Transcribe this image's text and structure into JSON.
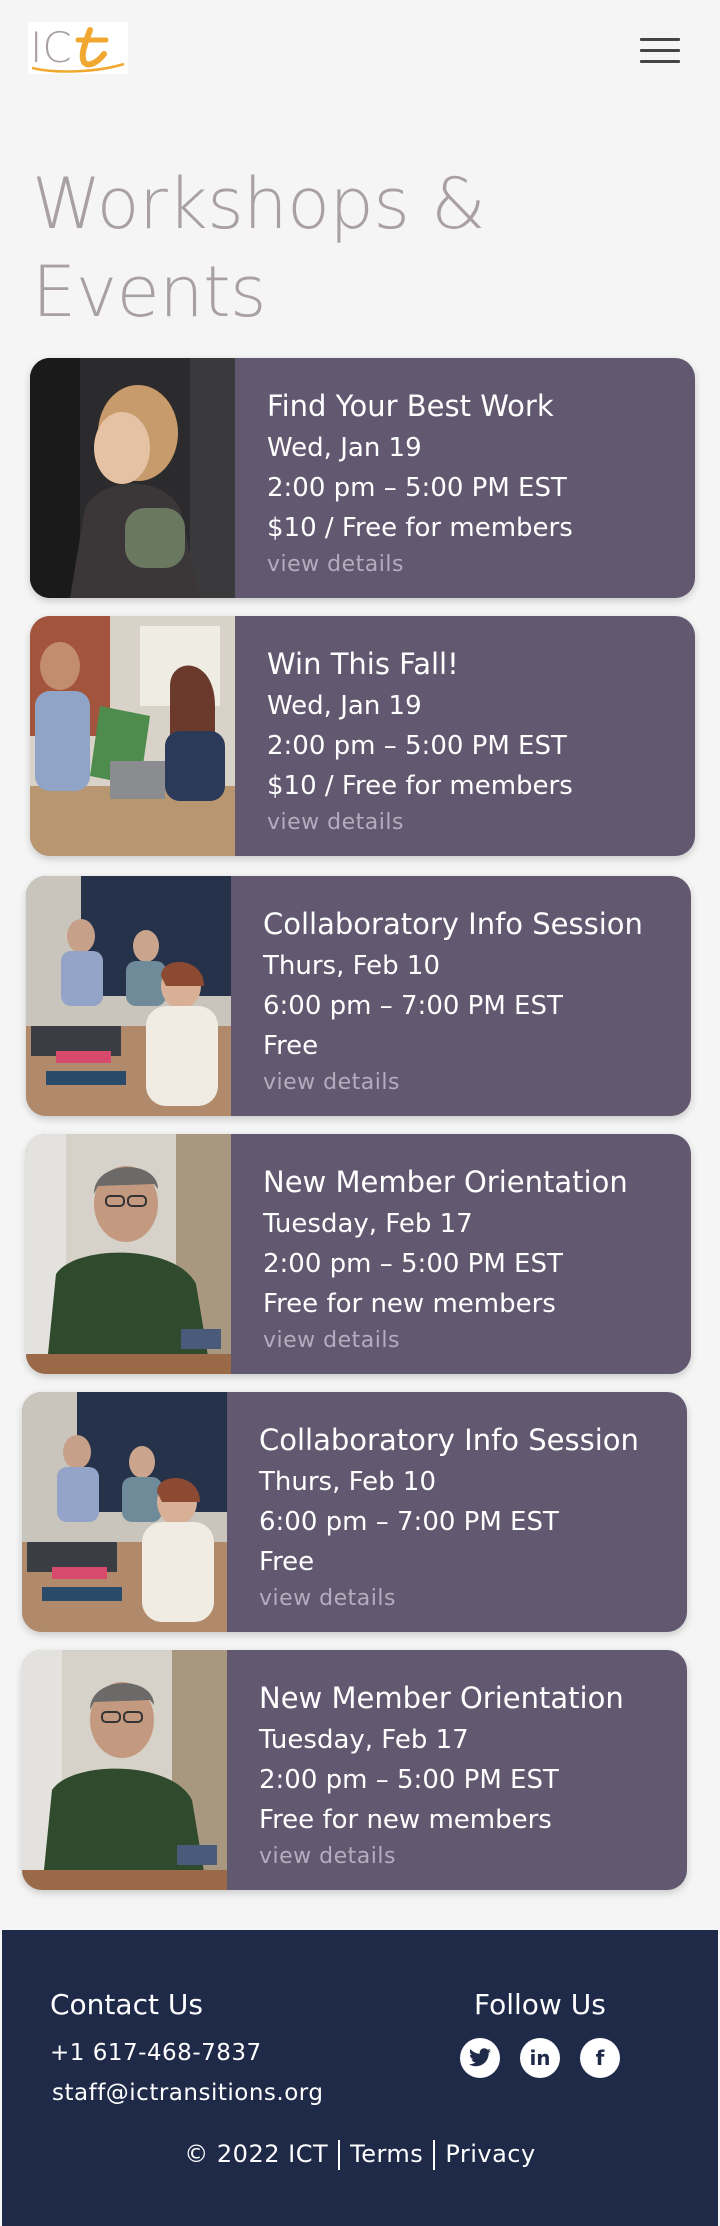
{
  "header": {
    "logo_text": "ICt",
    "menu_icon": "hamburger-icon"
  },
  "page_title": "Workshops & Events",
  "events": [
    {
      "title": "Find Your Best Work",
      "date": "Wed, Jan 19",
      "time": "2:00 pm – 5:00 PM EST",
      "price": "$10 / Free for members",
      "link": "view details"
    },
    {
      "title": "Win This Fall!",
      "date": "Wed, Jan 19",
      "time": "2:00 pm – 5:00 PM EST",
      "price": "$10 / Free for members",
      "link": "view details"
    },
    {
      "title": "Collaboratory Info Session",
      "date": "Thurs, Feb 10",
      "time": "6:00 pm – 7:00 PM EST",
      "price": "Free",
      "link": "view details"
    },
    {
      "title": "New Member Orientation",
      "date": "Tuesday, Feb 17",
      "time": "2:00 pm – 5:00 PM EST",
      "price": "Free for new members",
      "link": "view details"
    },
    {
      "title": "Collaboratory Info Session",
      "date": "Thurs, Feb 10",
      "time": "6:00 pm – 7:00 PM EST",
      "price": "Free",
      "link": "view details"
    },
    {
      "title": "New Member Orientation",
      "date": "Tuesday, Feb 17",
      "time": "2:00 pm – 5:00 PM EST",
      "price": "Free for new members",
      "link": "view details"
    }
  ],
  "footer": {
    "contact_title": "Contact Us",
    "phone": "+1 617-468-7837",
    "email": "staff@ictransitions.org",
    "follow_title": "Follow Us",
    "socials": [
      {
        "icon": "twitter-icon",
        "glyph": "🐦"
      },
      {
        "icon": "linkedin-icon",
        "glyph": "in"
      },
      {
        "icon": "facebook-icon",
        "glyph": "f"
      }
    ],
    "copyright": "© 2022 ICT",
    "terms": "Terms",
    "privacy": "Privacy"
  },
  "colors": {
    "card_bg": "#625870",
    "footer_bg": "#1f2a49",
    "title_color": "#a9a0a2",
    "logo_accent": "#f0a830"
  }
}
